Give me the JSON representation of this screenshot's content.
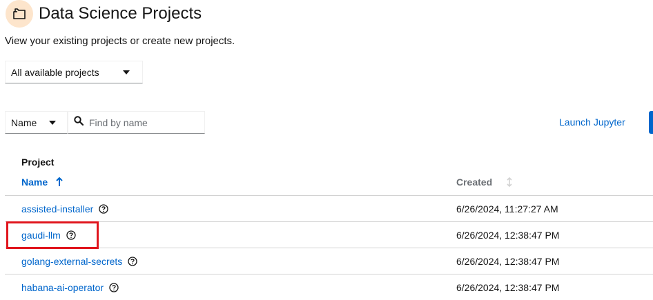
{
  "header": {
    "title": "Data Science Projects",
    "icon": "folder-icon",
    "icon_bg": "#fde5cc"
  },
  "subtitle": "View your existing projects or create new projects.",
  "project_filter": {
    "selected": "All available projects"
  },
  "toolbar": {
    "filter_type": "Name",
    "search_placeholder": "Find by name",
    "search_value": "",
    "launch_label": "Launch Jupyter"
  },
  "table": {
    "group_header": "Project",
    "columns": {
      "name": "Name",
      "created": "Created"
    },
    "sort": {
      "column": "Name",
      "direction": "ascending"
    },
    "rows": [
      {
        "name": "assisted-installer",
        "created": "6/26/2024, 11:27:27 AM"
      },
      {
        "name": "gaudi-llm",
        "created": "6/26/2024, 12:38:47 PM"
      },
      {
        "name": "golang-external-secrets",
        "created": "6/26/2024, 12:38:47 PM"
      },
      {
        "name": "habana-ai-operator",
        "created": "6/26/2024, 12:38:47 PM"
      }
    ]
  },
  "colors": {
    "link": "#0066cc",
    "highlight": "#e0151d"
  }
}
